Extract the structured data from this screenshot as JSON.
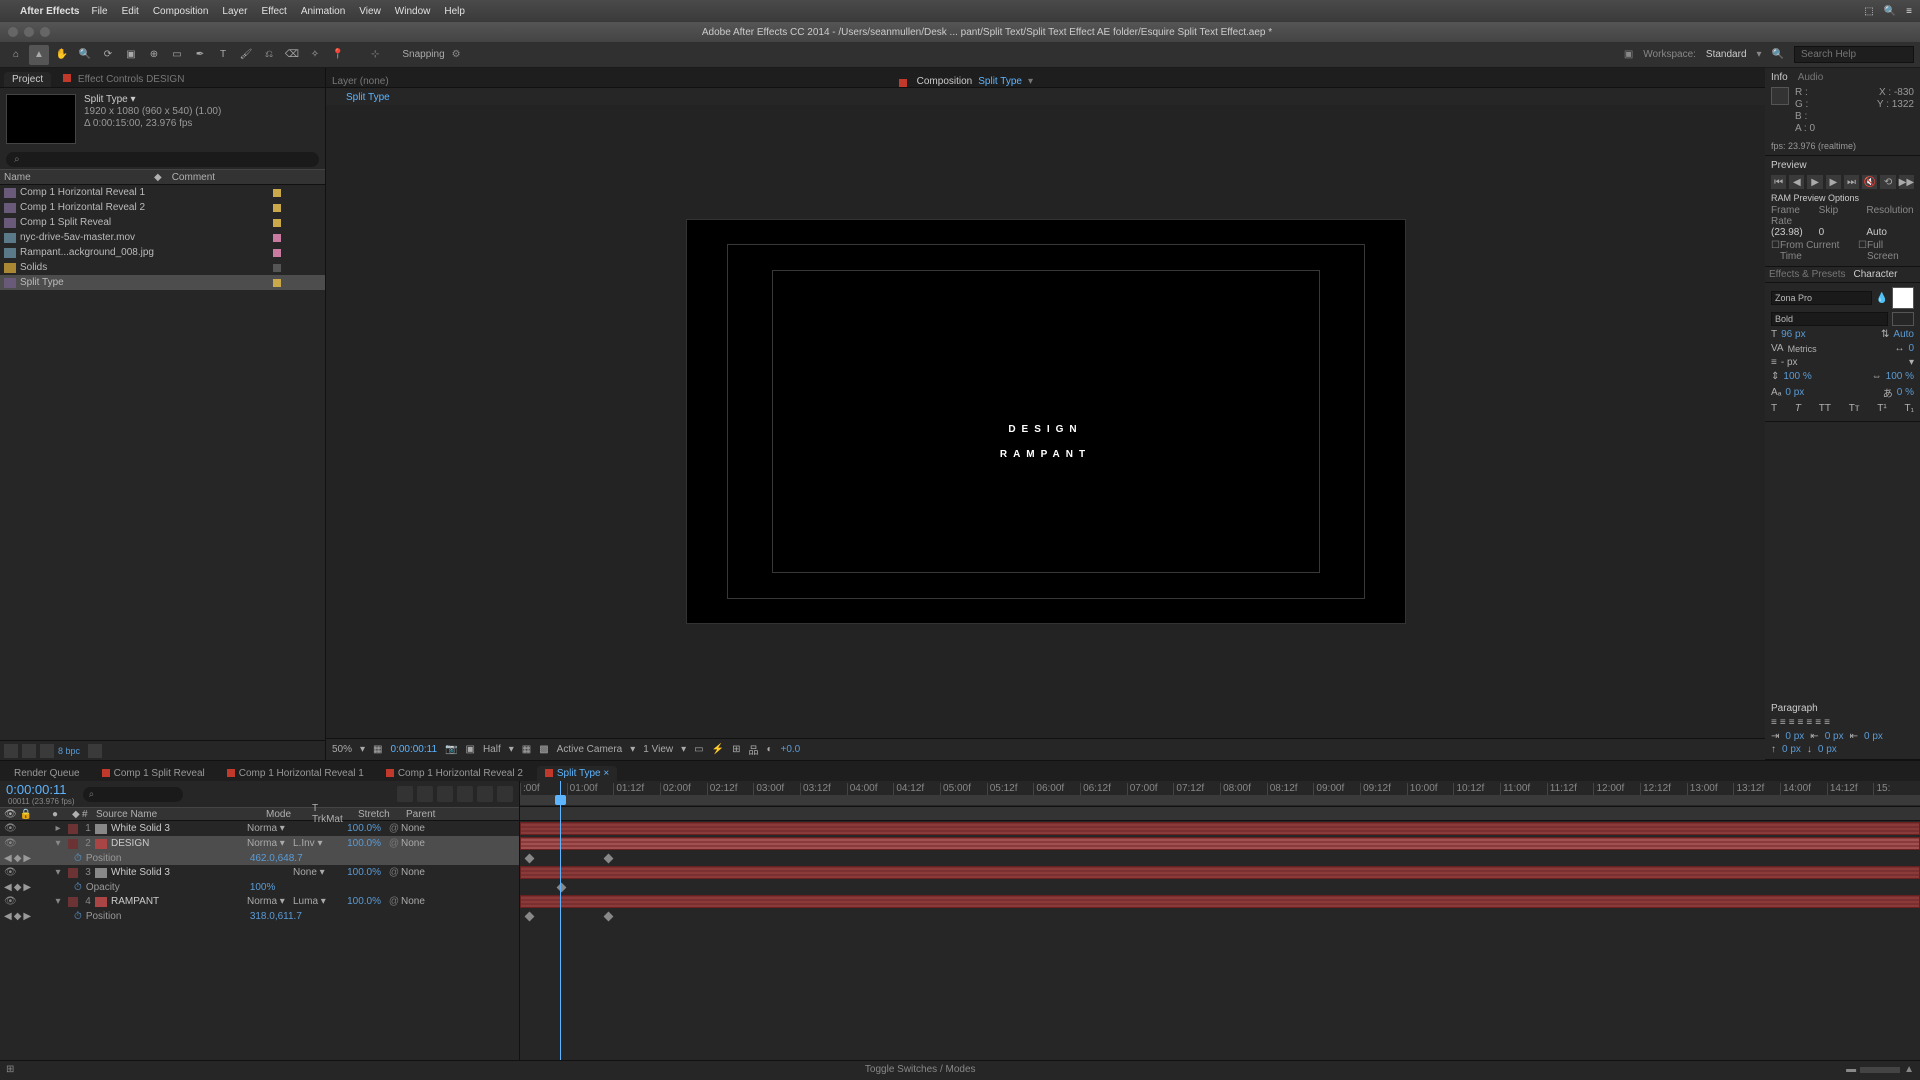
{
  "macos_menu": {
    "app_name": "After Effects",
    "items": [
      "File",
      "Edit",
      "Composition",
      "Layer",
      "Effect",
      "Animation",
      "View",
      "Window",
      "Help"
    ]
  },
  "window_title": "Adobe After Effects CC 2014 - /Users/seanmullen/Desk ... pant/Split Text/Split Text Effect AE folder/Esquire Split Text Effect.aep *",
  "toolbar": {
    "snapping_label": "Snapping",
    "workspace_label": "Workspace:",
    "workspace_value": "Standard",
    "search_placeholder": "Search Help"
  },
  "project_panel": {
    "tab_project": "Project",
    "tab_effectcontrols": "Effect Controls DESIGN",
    "selected_name": "Split Type ▾",
    "meta_line1": "1920 x 1080 (960 x 540) (1.00)",
    "meta_line2": "Δ 0:00:15:00, 23.976 fps",
    "col_name": "Name",
    "col_comment": "Comment",
    "items": [
      {
        "name": "Comp 1 Horizontal Reveal 1",
        "type": "comp",
        "label": "yellow"
      },
      {
        "name": "Comp 1 Horizontal Reveal 2",
        "type": "comp",
        "label": "yellow"
      },
      {
        "name": "Comp 1 Split Reveal",
        "type": "comp",
        "label": "yellow"
      },
      {
        "name": "nyc-drive-5av-master.mov",
        "type": "footage",
        "label": "pink"
      },
      {
        "name": "Rampant...ackground_008.jpg",
        "type": "footage",
        "label": "pink"
      },
      {
        "name": "Solids",
        "type": "folder",
        "label": "none"
      },
      {
        "name": "Split Type",
        "type": "comp",
        "label": "yellow",
        "selected": true
      }
    ],
    "bpc": "8 bpc"
  },
  "composition_panel": {
    "layer_none": "Layer (none)",
    "comp_label": "Composition",
    "comp_name": "Split Type",
    "breadcrumb": "Split Type",
    "render_line1": "RAMPANT",
    "render_line2": "DESIGN"
  },
  "viewer_footer": {
    "zoom": "50%",
    "timecode": "0:00:00:11",
    "resolution": "Half",
    "camera": "Active Camera",
    "view": "1 View",
    "exposure": "+0.0"
  },
  "right_panels": {
    "info_tab": "Info",
    "audio_tab": "Audio",
    "info_r": "R :",
    "info_g": "G :",
    "info_b": "B :",
    "info_a": "A : 0",
    "info_x": "X : -830",
    "info_y": "Y :  1322",
    "info_fps": "fps: 23.976 (realtime)",
    "preview_tab": "Preview",
    "ram_options": "RAM Preview Options",
    "frame_rate_label": "Frame Rate",
    "skip_label": "Skip",
    "resolution_label": "Resolution",
    "frame_rate_val": "(23.98)",
    "skip_val": "0",
    "resolution_val": "Auto",
    "from_current": "From Current Time",
    "full_screen": "Full Screen",
    "effects_presets": "Effects & Presets",
    "character_tab": "Character",
    "font_family": "Zona Pro",
    "font_style": "Bold",
    "font_size": "96 px",
    "leading": "Auto",
    "kerning": "Metrics",
    "tracking": "0",
    "stroke_w": "- px",
    "scale_h": "100 %",
    "scale_v": "100 %",
    "baseline": "0 px",
    "tsume": "0 %",
    "paragraph_tab": "Paragraph",
    "para_indent_left": "0 px",
    "para_indent_right": "0 px",
    "para_indent_first": "0 px",
    "para_space_before": "0 px",
    "para_space_after": "0 px"
  },
  "timeline": {
    "tabs": [
      "Render Queue",
      "Comp 1 Split Reveal",
      "Comp 1 Horizontal Reveal 1",
      "Comp 1 Horizontal Reveal 2",
      "Split Type"
    ],
    "active_tab_index": 4,
    "current_time": "0:00:00:11",
    "current_frame": "00011 (23.976 fps)",
    "cols": {
      "av": "",
      "idx": "#",
      "source": "Source Name",
      "mode": "Mode",
      "trkmat": "T  TrkMat",
      "stretch": "Stretch",
      "parent": "Parent"
    },
    "layers": [
      {
        "idx": "1",
        "name": "White Solid 3",
        "icon": "solid",
        "mode": "Norma ▾",
        "trk": "",
        "stretch": "100.0%",
        "parent": "None"
      },
      {
        "idx": "2",
        "name": "DESIGN",
        "icon": "text",
        "mode": "Norma ▾",
        "trk": "L.Inv ▾",
        "stretch": "100.0%",
        "parent": "None",
        "selected": true,
        "props": [
          {
            "name": "Position",
            "value": "462.0,648.7",
            "kf": true
          }
        ]
      },
      {
        "idx": "3",
        "name": "White Solid 3",
        "icon": "solid",
        "mode": "",
        "trk": "None ▾",
        "stretch": "100.0%",
        "parent": "None",
        "props": [
          {
            "name": "Opacity",
            "value": "100%",
            "kf": true
          }
        ]
      },
      {
        "idx": "4",
        "name": "RAMPANT",
        "icon": "text",
        "mode": "Norma ▾",
        "trk": "Luma ▾",
        "stretch": "100.0%",
        "parent": "None",
        "props": [
          {
            "name": "Position",
            "value": "318.0,611.7",
            "kf": true
          }
        ]
      }
    ],
    "ruler_ticks": [
      ":00f",
      "01:00f",
      "01:12f",
      "02:00f",
      "02:12f",
      "03:00f",
      "03:12f",
      "04:00f",
      "04:12f",
      "05:00f",
      "05:12f",
      "06:00f",
      "06:12f",
      "07:00f",
      "07:12f",
      "08:00f",
      "08:12f",
      "09:00f",
      "09:12f",
      "10:00f",
      "10:12f",
      "11:00f",
      "11:12f",
      "12:00f",
      "12:12f",
      "13:00f",
      "13:12f",
      "14:00f",
      "14:12f",
      "15:"
    ],
    "toggle_switches": "Toggle Switches / Modes"
  }
}
